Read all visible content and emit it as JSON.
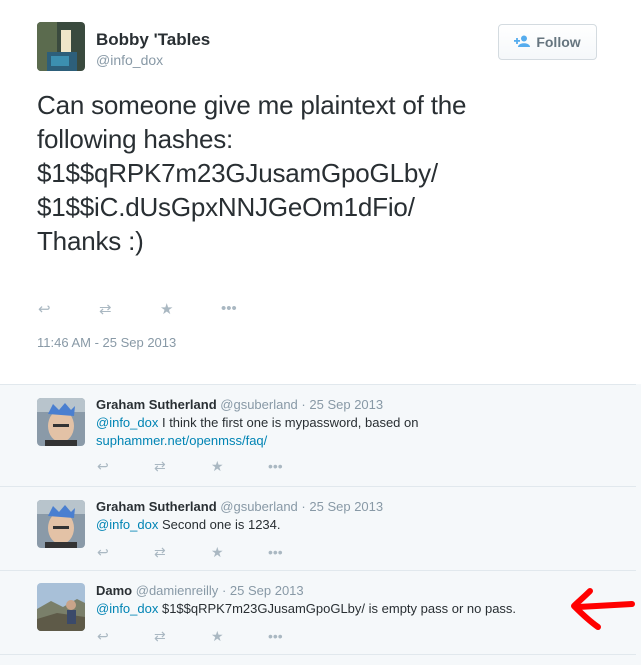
{
  "main": {
    "name": "Bobby 'Tables",
    "handle": "@info_dox",
    "follow_label": "Follow",
    "text_lines": [
      "Can someone give me plaintext of the",
      "following hashes:",
      "$1$$qRPK7m23GJusamGpoGLby/",
      "$1$$iC.dUsGpxNNJGeOm1dFio/",
      "",
      "Thanks :)"
    ],
    "timestamp": "11:46 AM - 25 Sep 2013",
    "actions": {
      "reply_icon": "↩",
      "retweet_icon": "⇄",
      "favorite_icon": "★",
      "more_icon": "•••"
    }
  },
  "replies": [
    {
      "name": "Graham Sutherland",
      "handle": "@gsuberland",
      "dot": "·",
      "time": "25 Sep 2013",
      "mention": "@info_dox",
      "text": " I think the first one is mypassword, based on",
      "link": "suphammer.net/openmss/faq/"
    },
    {
      "name": "Graham Sutherland",
      "handle": "@gsuberland",
      "dot": "·",
      "time": "25 Sep 2013",
      "mention": "@info_dox",
      "text": " Second one is 1234."
    },
    {
      "name": "Damo",
      "handle": "@damienreilly",
      "dot": "·",
      "time": "25 Sep 2013",
      "mention": "@info_dox",
      "text": " $1$$qRPK7m23GJusamGpoGLby/ is empty pass or no pass."
    }
  ],
  "colors": {
    "accent": "#55acee",
    "link": "#0084b4",
    "annotation_arrow": "#ff0000"
  }
}
